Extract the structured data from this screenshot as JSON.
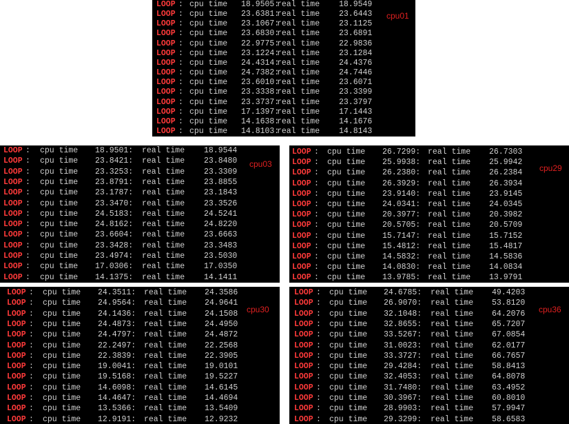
{
  "colors": {
    "background": "#000000",
    "text": "#d0d0d0",
    "loop_label": "#ff3a3a",
    "tag": "#e02020"
  },
  "labels": {
    "loop": "LOOP",
    "colon": ":",
    "cpu": "cpu time",
    "real": "real time"
  },
  "panels": [
    {
      "tag": "cpu01",
      "rows": [
        [
          "18.9505",
          "18.9549"
        ],
        [
          "23.6381",
          "23.6443"
        ],
        [
          "23.1067",
          "23.1125"
        ],
        [
          "23.6830",
          "23.6891"
        ],
        [
          "22.9775",
          "22.9836"
        ],
        [
          "23.1224",
          "23.1284"
        ],
        [
          "24.4314",
          "24.4376"
        ],
        [
          "24.7382",
          "24.7446"
        ],
        [
          "23.6010",
          "23.6071"
        ],
        [
          "23.3338",
          "23.3399"
        ],
        [
          "23.3737",
          "23.3797"
        ],
        [
          "17.1397",
          "17.1443"
        ],
        [
          "14.1638",
          "14.1676"
        ],
        [
          "14.8103",
          "14.8143"
        ]
      ]
    },
    {
      "tag": "cpu03",
      "rows": [
        [
          "18.9501",
          "18.9544"
        ],
        [
          "23.8421",
          "23.8480"
        ],
        [
          "23.3253",
          "23.3309"
        ],
        [
          "23.8791",
          "23.8855"
        ],
        [
          "23.1787",
          "23.1843"
        ],
        [
          "23.3470",
          "23.3526"
        ],
        [
          "24.5183",
          "24.5241"
        ],
        [
          "24.8162",
          "24.8220"
        ],
        [
          "23.6604",
          "23.6663"
        ],
        [
          "23.3428",
          "23.3483"
        ],
        [
          "23.4974",
          "23.5030"
        ],
        [
          "17.0306",
          "17.0350"
        ],
        [
          "14.1375",
          "14.1411"
        ]
      ]
    },
    {
      "tag": "cpu29",
      "rows": [
        [
          "26.7299",
          "26.7303"
        ],
        [
          "25.9938",
          "25.9942"
        ],
        [
          "26.2380",
          "26.2384"
        ],
        [
          "26.3929",
          "26.3934"
        ],
        [
          "23.9140",
          "23.9145"
        ],
        [
          "24.0341",
          "24.0345"
        ],
        [
          "20.3977",
          "20.3982"
        ],
        [
          "20.5705",
          "20.5709"
        ],
        [
          "15.7147",
          "15.7152"
        ],
        [
          "15.4812",
          "15.4817"
        ],
        [
          "14.5832",
          "14.5836"
        ],
        [
          "14.0830",
          "14.0834"
        ],
        [
          "13.9785",
          "13.9791"
        ]
      ]
    },
    {
      "tag": "cpu30",
      "rows": [
        [
          "24.3511",
          "24.3586"
        ],
        [
          "24.9564",
          "24.9641"
        ],
        [
          "24.1436",
          "24.1508"
        ],
        [
          "24.4873",
          "24.4950"
        ],
        [
          "24.4797",
          "24.4872"
        ],
        [
          "22.2497",
          "22.2568"
        ],
        [
          "22.3839",
          "22.3905"
        ],
        [
          "19.0041",
          "19.0101"
        ],
        [
          "19.5168",
          "19.5227"
        ],
        [
          "14.6098",
          "14.6145"
        ],
        [
          "14.4647",
          "14.4694"
        ],
        [
          "13.5366",
          "13.5409"
        ],
        [
          "12.9191",
          "12.9232"
        ]
      ]
    },
    {
      "tag": "cpu36",
      "rows": [
        [
          "24.6785",
          "49.4203"
        ],
        [
          "26.9070",
          "53.8120"
        ],
        [
          "32.1048",
          "64.2076"
        ],
        [
          "32.8655",
          "65.7207"
        ],
        [
          "33.5267",
          "67.0854"
        ],
        [
          "31.0023",
          "62.0177"
        ],
        [
          "33.3727",
          "66.7657"
        ],
        [
          "29.4284",
          "58.8413"
        ],
        [
          "32.4053",
          "64.8078"
        ],
        [
          "31.7480",
          "63.4952"
        ],
        [
          "30.3967",
          "60.8010"
        ],
        [
          "28.9903",
          "57.9947"
        ],
        [
          "29.3299",
          "58.6583"
        ]
      ]
    }
  ]
}
